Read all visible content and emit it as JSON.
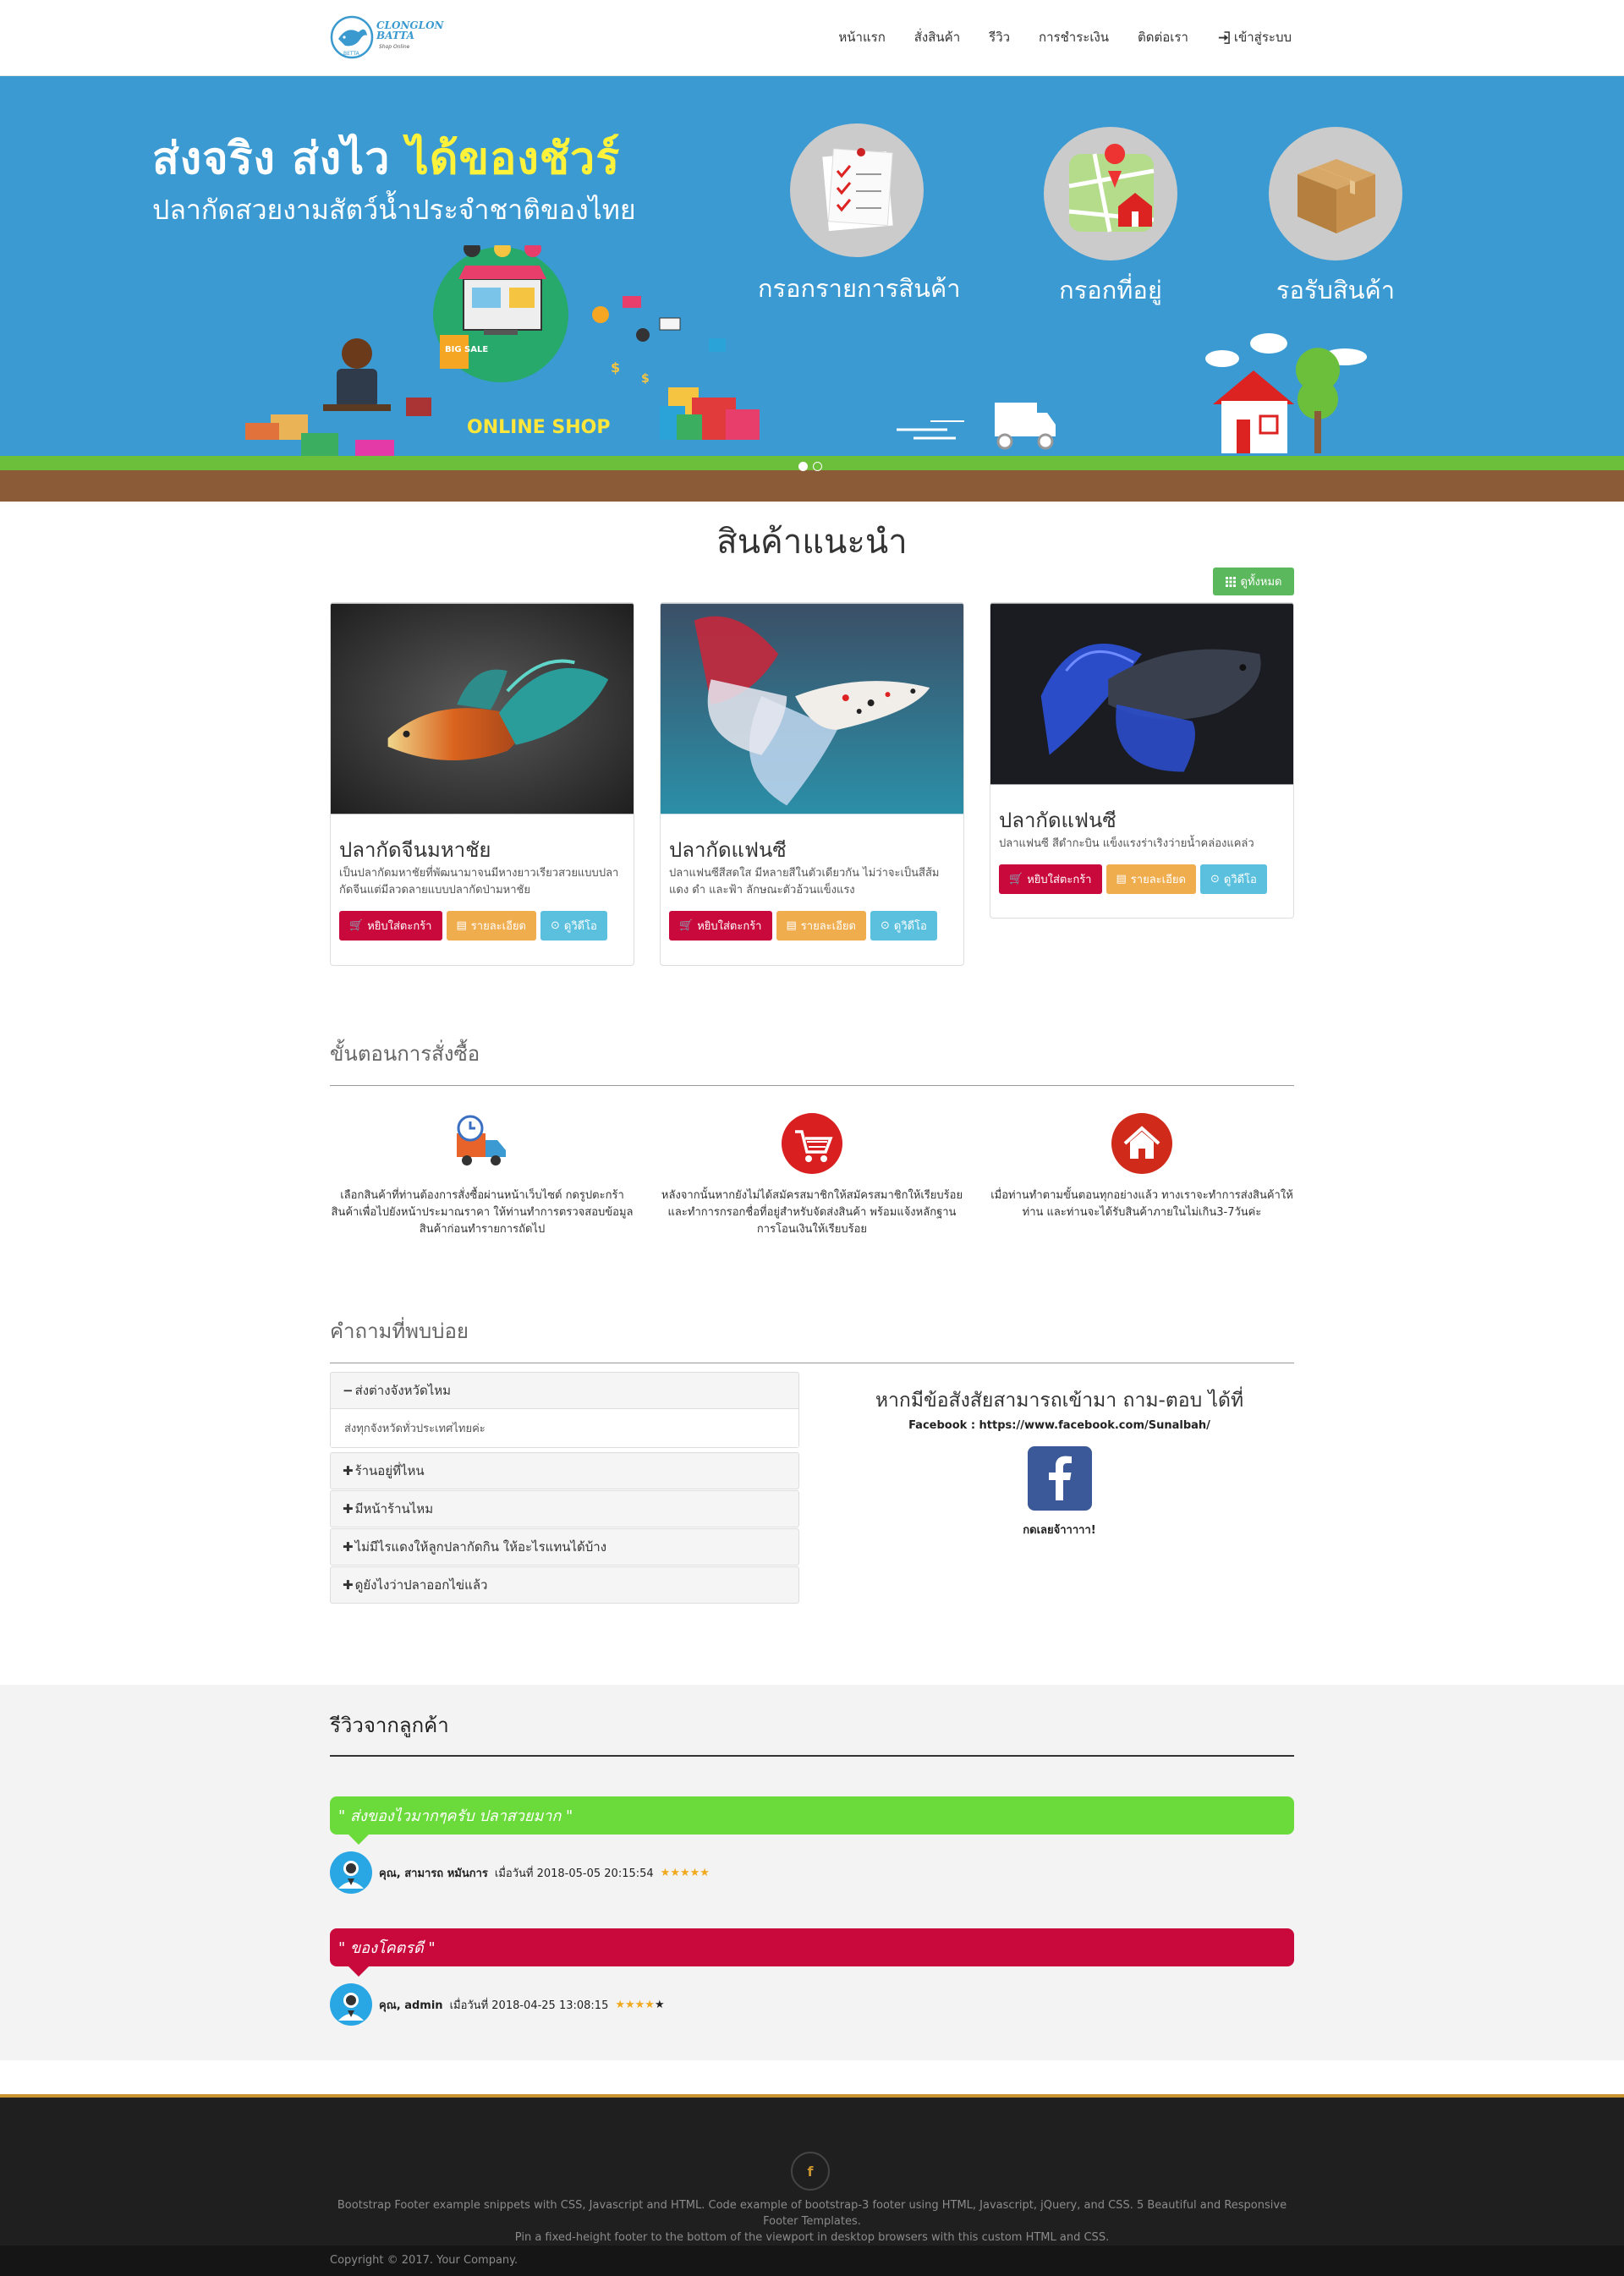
{
  "nav": {
    "logo_text": "CLONGLON BATTA",
    "logo_sub": "Shop Online",
    "links": [
      "หน้าแรก",
      "สั่งสินค้า",
      "รีวิว",
      "การชำระเงิน",
      "ติดต่อเรา"
    ],
    "login": "เข้าสู่ระบบ"
  },
  "hero": {
    "title_white": "ส่งจริง ส่งไว",
    "title_yellow": "ได้ของชัวร์",
    "subtitle": "ปลากัดสวยงามสัตว์น้ำประจำชาติของไทย",
    "steps": [
      "กรอกรายการสินค้า",
      "กรอกที่อยู่",
      "รอรับสินค้า"
    ],
    "online_shop": "ONLINE SHOP",
    "big_sale": "BIG SALE",
    "slides": 2,
    "active_slide": 1
  },
  "featured": {
    "title": "สินค้าแนะนำ",
    "view_all": "ดูทั้งหมด",
    "buttons": {
      "cart": "หยิบใส่ตะกร้า",
      "detail": "รายละเอียด",
      "video": "ดูวิดีโอ"
    },
    "products": [
      {
        "name": "ปลากัดจีนมหาชัย",
        "desc": "เป็นปลากัดมหาชัยที่พัฒนามาจนมีหางยาวเรียวสวยแบบปลากัดจีนแต่มีลวดลายแบบปลากัดป่ามหาชัย"
      },
      {
        "name": "ปลากัดแฟนซี",
        "desc": "ปลาแฟนซีสีสดใส มีหลายสีในตัวเดียวกัน ไม่ว่าจะเป็นสีส้ม แดง ดำ และฟ้า ลักษณะตัวอ้วนแข็งแรง"
      },
      {
        "name": "ปลากัดแฟนซี",
        "desc": "ปลาแฟนซี สีดำกะบิน แข็งแรงร่าเริงว่ายน้ำคล่องแคล่ว"
      }
    ]
  },
  "order_steps": {
    "title": "ขั้นตอนการสั่งซื้อ",
    "steps": [
      {
        "icon": "delivery-truck-icon",
        "text": "เลือกสินค้าที่ท่านต้องการสั่งซื้อผ่านหน้าเว็บไซต์ กดรูปตะกร้าสินค้าเพื่อไปยังหน้าประมาณราคา ให้ท่านทำการตรวจสอบข้อมูลสินค้าก่อนทำรายการถัดไป"
      },
      {
        "icon": "shopping-cart-icon",
        "text": "หลังจากนั้นหากยังไม่ได้สมัครสมาชิกให้สมัครสมาชิกให้เรียบร้อย และทำการกรอกชื่อที่อยู่สำหรับจัดส่งสินค้า พร้อมแจ้งหลักฐานการโอนเงินให้เรียบร้อย"
      },
      {
        "icon": "home-icon",
        "text": "เมื่อท่านทำตามขั้นตอนทุกอย่างแล้ว ทางเราจะทำการส่งสินค้าให้ท่าน และท่านจะได้รับสินค้าภายในไม่เกิน3-7วันค่ะ"
      }
    ]
  },
  "faq": {
    "title": "คำถามที่พบบ่อย",
    "items": [
      {
        "q": "ส่งต่างจังหวัดไหม",
        "a": "ส่งทุกจังหวัดทั่วประเทศไทยค่ะ",
        "open": true
      },
      {
        "q": "ร้านอยู่ที่ไหน",
        "open": false
      },
      {
        "q": " มีหน้าร้านไหม",
        "open": false
      },
      {
        "q": "ไม่มีไรแดงให้ลูกปลากัดกิน ให้อะไรแทนได้บ้าง",
        "open": false
      },
      {
        "q": "ดูยังไงว่าปลาออกไข่แล้ว",
        "open": false
      }
    ],
    "ask_title": "หากมีข้อสังสัยสามารถเข้ามา ถาม-ตอบ ได้ที่",
    "facebook": "Facebook : https://www.facebook.com/Sunalbah/",
    "fb_cta": "กดเลยจ้าาาาา!"
  },
  "reviews": {
    "title": "รีวิวจากลูกค้า",
    "items": [
      {
        "quote": "\" ส่งของไวมากๆครับ ปลาสวยมาก \"",
        "color": "#6bdb3b",
        "name": "คุณ, สามารถ หมันการ",
        "date": "เมื่อวันที่ 2018-05-05 20:15:54",
        "rating": 5
      },
      {
        "quote": "\" ของโคตรดี \"",
        "color": "#c9093c",
        "name": "คุณ, admin",
        "date": "เมื่อวันที่ 2018-04-25 13:08:15",
        "rating": 4
      }
    ]
  },
  "footer": {
    "fb_letter": "f",
    "text1": "Bootstrap Footer example snippets with CSS, Javascript and HTML. Code example of bootstrap-3 footer using HTML, Javascript, jQuery, and CSS. 5 Beautiful and Responsive Footer Templates.",
    "text2": "Pin a fixed-height footer to the bottom of the viewport in desktop browsers with this custom HTML and CSS.",
    "copyright": "Copyright © 2017. Your Company."
  },
  "colors": {
    "hero": "#3b9ad2",
    "cart": "#c9093c",
    "detail": "#f0ad4e",
    "video": "#5bc0de",
    "view_all": "#5cb85c",
    "review_green": "#6bdb3b",
    "review_red": "#c9093c",
    "footer_accent": "#c9932f"
  }
}
